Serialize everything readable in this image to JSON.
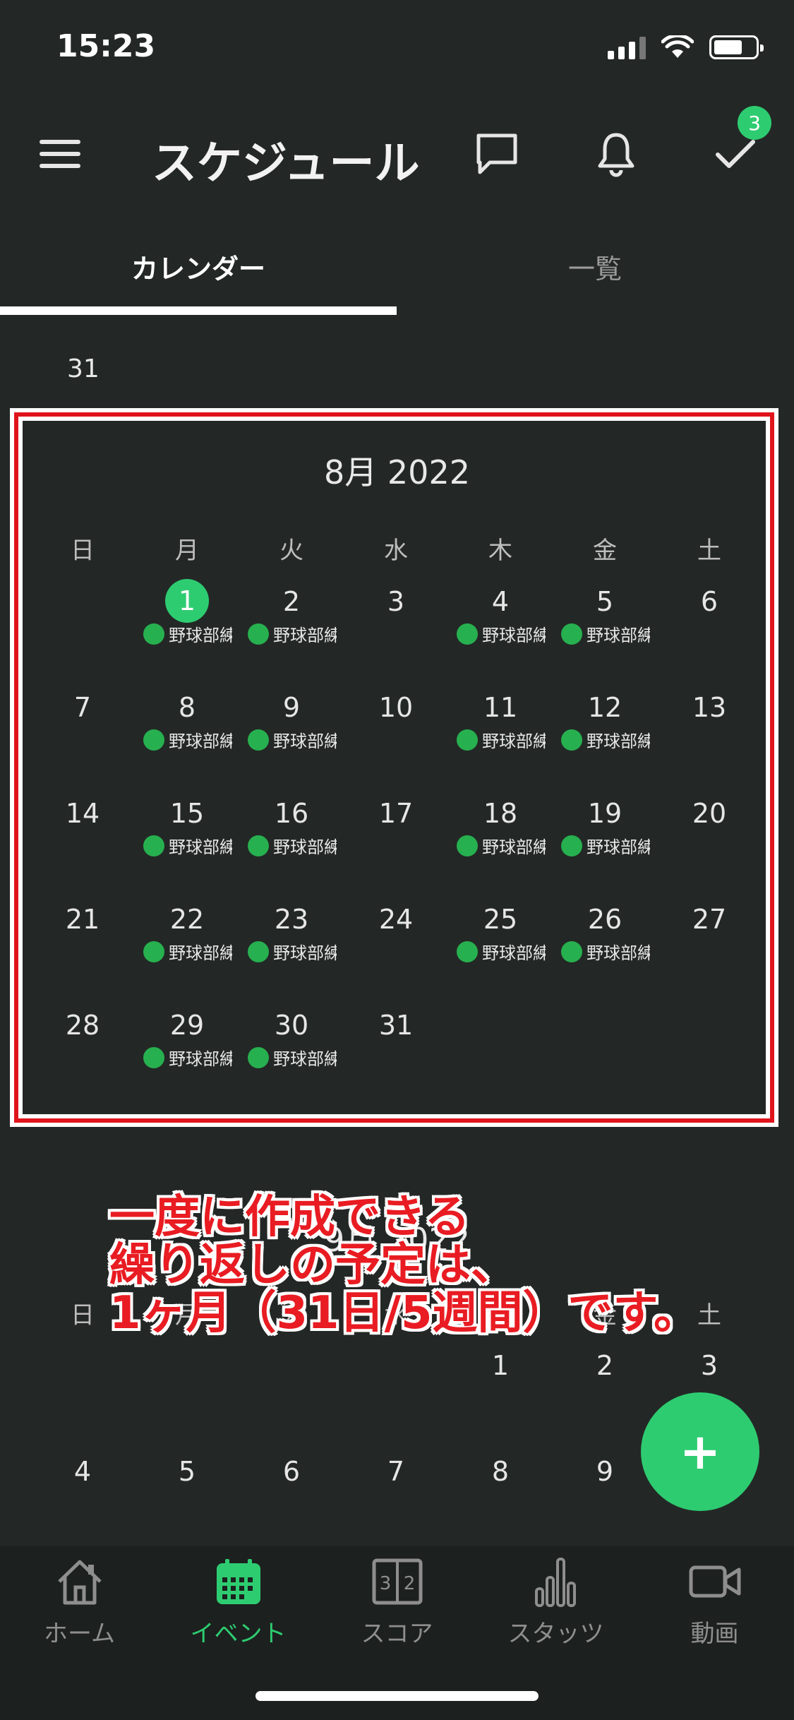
{
  "status_bar": {
    "time": "15:23"
  },
  "header": {
    "title": "スケジュール",
    "badge_count": "3"
  },
  "tabs": [
    {
      "label": "カレンダー",
      "active": true
    },
    {
      "label": "一覧",
      "active": false
    }
  ],
  "prev_month_tail": "31",
  "calendar": {
    "title": "8月 2022",
    "weekdays": [
      "日",
      "月",
      "火",
      "水",
      "木",
      "金",
      "土"
    ],
    "event_label": "野球部練",
    "weeks": [
      [
        {
          "d": ""
        },
        {
          "d": "1",
          "today": true,
          "ev": true
        },
        {
          "d": "2",
          "ev": true
        },
        {
          "d": "3"
        },
        {
          "d": "4",
          "ev": true
        },
        {
          "d": "5",
          "ev": true
        },
        {
          "d": "6"
        }
      ],
      [
        {
          "d": "7"
        },
        {
          "d": "8",
          "ev": true
        },
        {
          "d": "9",
          "ev": true
        },
        {
          "d": "10"
        },
        {
          "d": "11",
          "ev": true
        },
        {
          "d": "12",
          "ev": true
        },
        {
          "d": "13"
        }
      ],
      [
        {
          "d": "14"
        },
        {
          "d": "15",
          "ev": true
        },
        {
          "d": "16",
          "ev": true
        },
        {
          "d": "17"
        },
        {
          "d": "18",
          "ev": true
        },
        {
          "d": "19",
          "ev": true
        },
        {
          "d": "20"
        }
      ],
      [
        {
          "d": "21"
        },
        {
          "d": "22",
          "ev": true
        },
        {
          "d": "23",
          "ev": true
        },
        {
          "d": "24"
        },
        {
          "d": "25",
          "ev": true
        },
        {
          "d": "26",
          "ev": true
        },
        {
          "d": "27"
        }
      ],
      [
        {
          "d": "28"
        },
        {
          "d": "29",
          "ev": true
        },
        {
          "d": "30",
          "ev": true
        },
        {
          "d": "31"
        },
        {
          "d": ""
        },
        {
          "d": ""
        },
        {
          "d": ""
        }
      ]
    ]
  },
  "next_month": {
    "title": "9月 2022",
    "weekdays": [
      "日",
      "月",
      "火",
      "水",
      "木",
      "金",
      "土"
    ],
    "weeks": [
      [
        "",
        "",
        "",
        "",
        "1",
        "2",
        "3"
      ],
      [
        "4",
        "5",
        "6",
        "7",
        "8",
        "9",
        ""
      ]
    ]
  },
  "annotation": {
    "line1": "一度に作成できる",
    "line2": "繰り返しの予定は、",
    "line3": "1ヶ月（31日/5週間）です。"
  },
  "fab_label": "+",
  "bottom_nav": [
    {
      "label": "ホーム",
      "icon": "home-icon",
      "active": false
    },
    {
      "label": "イベント",
      "icon": "calendar-icon",
      "active": true
    },
    {
      "label": "スコア",
      "icon": "scoreboard-icon",
      "active": false
    },
    {
      "label": "スタッツ",
      "icon": "stats-icon",
      "active": false
    },
    {
      "label": "動画",
      "icon": "video-icon",
      "active": false
    }
  ],
  "colors": {
    "accent": "#2ecc71",
    "background": "#232826",
    "annotation_red": "#e0141b"
  }
}
